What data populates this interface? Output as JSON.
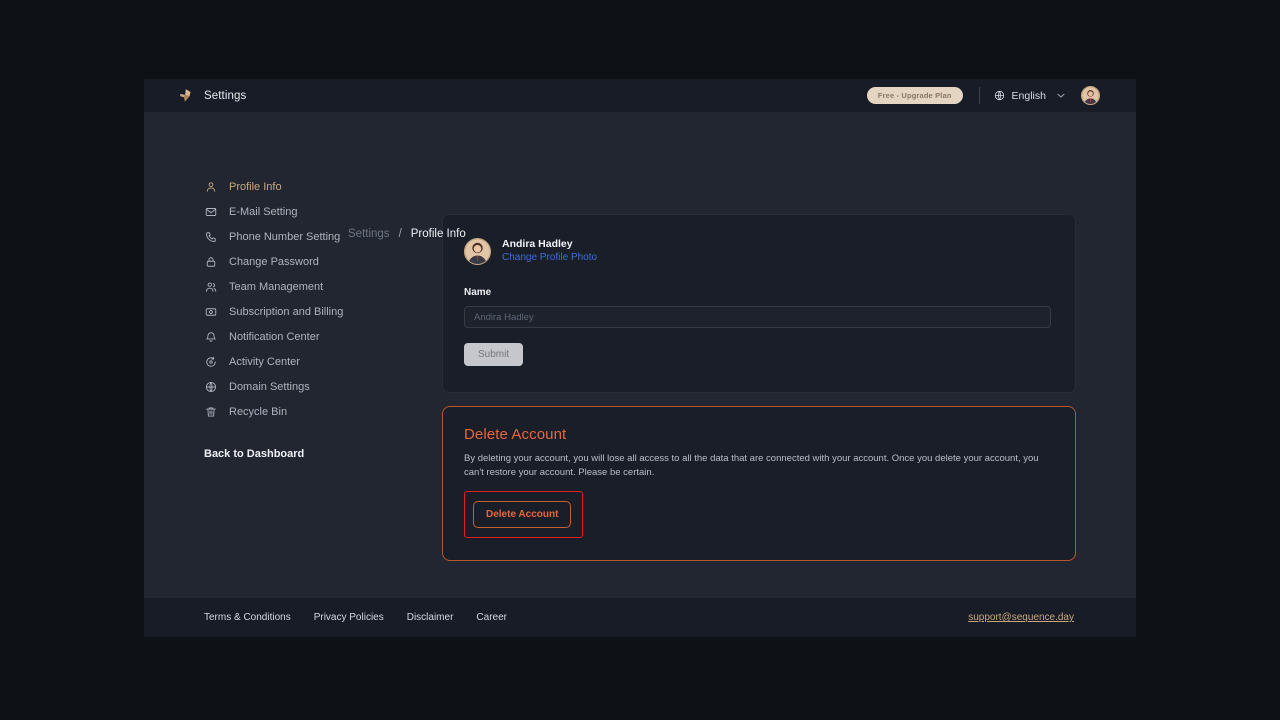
{
  "header": {
    "logo_icon": "sequence-logo-icon",
    "title": "Settings",
    "plan_badge": "Free - Upgrade Plan",
    "globe_icon": "globe-icon",
    "language": "English",
    "chevron_icon": "chevron-down-icon",
    "avatar_icon": "user-avatar"
  },
  "breadcrumb": {
    "parent": "Settings",
    "separator": "/",
    "current": "Profile Info"
  },
  "sidebar": {
    "items": [
      {
        "label": "Profile Info",
        "icon": "user-icon",
        "active": true
      },
      {
        "label": "E-Mail Setting",
        "icon": "envelope-icon",
        "active": false
      },
      {
        "label": "Phone Number Setting",
        "icon": "phone-icon",
        "active": false
      },
      {
        "label": "Change Password",
        "icon": "lock-icon",
        "active": false
      },
      {
        "label": "Team Management",
        "icon": "users-icon",
        "active": false
      },
      {
        "label": "Subscription and Billing",
        "icon": "billing-card-icon",
        "active": false
      },
      {
        "label": "Notification Center",
        "icon": "bell-icon",
        "active": false
      },
      {
        "label": "Activity Center",
        "icon": "activity-icon",
        "active": false
      },
      {
        "label": "Domain Settings",
        "icon": "globe-icon",
        "active": false
      },
      {
        "label": "Recycle Bin",
        "icon": "trash-icon",
        "active": false
      }
    ],
    "back_link": "Back to Dashboard"
  },
  "profile_card": {
    "user_name": "Andira Hadley",
    "change_photo_link": "Change Profile Photo",
    "name_label": "Name",
    "name_value": "",
    "name_placeholder": "Andira Hadley",
    "submit_label": "Submit"
  },
  "danger_zone": {
    "title": "Delete Account",
    "description": "By deleting your account, you will lose all access to all the data that are connected with your account. Once you delete your account, you can't restore your account. Please be certain.",
    "button_label": "Delete Account",
    "annotation_color": "#e01f1f",
    "accent_color": "#e8673a"
  },
  "footer": {
    "links": [
      "Terms & Conditions",
      "Privacy Policies",
      "Disclaimer",
      "Career"
    ],
    "email": "support@sequence.day"
  },
  "colors": {
    "page_bg": "#212631",
    "card_bg": "#1a1e28",
    "bar_bg": "#181c26",
    "accent_tan": "#c9a77e",
    "link_blue": "#3b6fd4",
    "danger_orange": "#e8673a"
  }
}
